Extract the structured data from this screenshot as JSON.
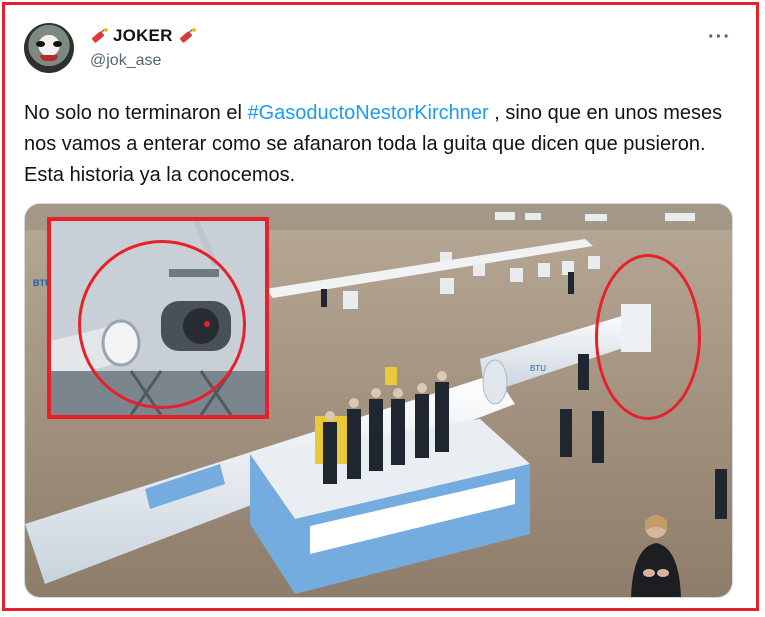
{
  "author": {
    "display_name": "JOKER",
    "handle": "@jok_ase",
    "avatar_icon": "joker-face-avatar",
    "name_badge_icon": "dynamite-icon"
  },
  "menu": {
    "more_icon": "more-dots-icon",
    "more_label": "···"
  },
  "tweet": {
    "text_before": "No solo no terminaron el ",
    "hashtag": "#GasoductoNestorKirchner",
    "text_after": " , sino que en unos meses nos vamos a enterar como se afanaron toda la guita que dicen que pusieron. Esta historia ya la conocemos."
  },
  "media": {
    "pipe_label": "BTU",
    "sign_label": "BTU"
  },
  "colors": {
    "accent": "#1d9bf0",
    "highlight": "#e8202a",
    "text": "#0f1419",
    "muted": "#536471"
  }
}
